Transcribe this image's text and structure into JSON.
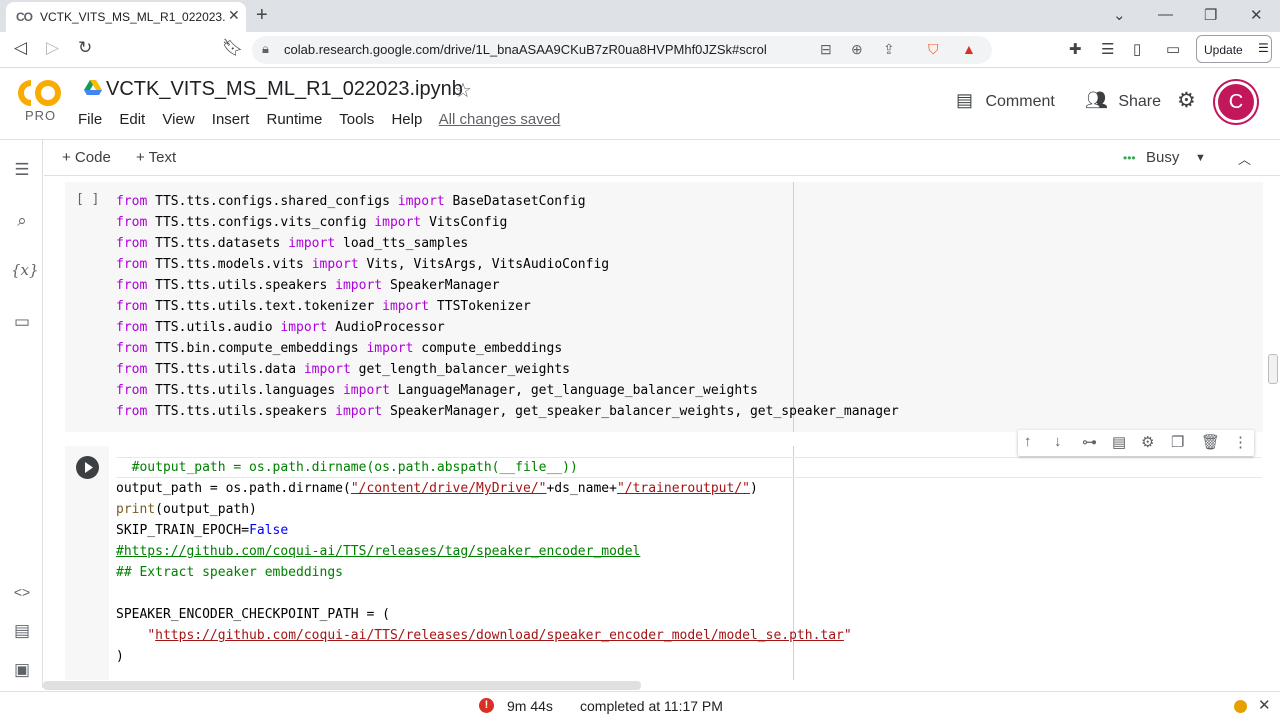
{
  "browser": {
    "tab_title": "VCTK_VITS_MS_ML_R1_022023.ipynb",
    "tab_favicon": "CO",
    "url": "colab.research.google.com/drive/1L_bnaASAA9CKuB7zR0ua8HVPMhf0JZSk#scrollT...",
    "update_label": "Update"
  },
  "colab": {
    "logo_text": "CO",
    "pro_label": "PRO",
    "notebook_title": "VCTK_VITS_MS_ML_R1_022023.ipynb",
    "menu": [
      "File",
      "Edit",
      "View",
      "Insert",
      "Runtime",
      "Tools",
      "Help"
    ],
    "saved_status": "All changes saved",
    "comment_label": "Comment",
    "share_label": "Share",
    "avatar_letter": "C"
  },
  "toolbar": {
    "add_code": "+ Code",
    "add_text": "+ Text",
    "runtime_status": "Busy",
    "runtime_dots": "•••"
  },
  "cell1": {
    "bracket": "[ ]"
  },
  "statusbar": {
    "elapsed": "9m 44s",
    "completed": "completed at 11:17 PM"
  },
  "colors": {
    "accent_orange": "#f9ab00",
    "avatar": "#c2185b",
    "error": "#d93025",
    "busy_dots": "#34a853"
  },
  "icons": [
    "list-icon",
    "search-icon",
    "variables-icon",
    "folder-icon",
    "code-snippets-icon",
    "command-palette-icon",
    "terminal-icon",
    "comment-icon",
    "people-icon",
    "gear-icon",
    "star-icon",
    "run-icon"
  ]
}
